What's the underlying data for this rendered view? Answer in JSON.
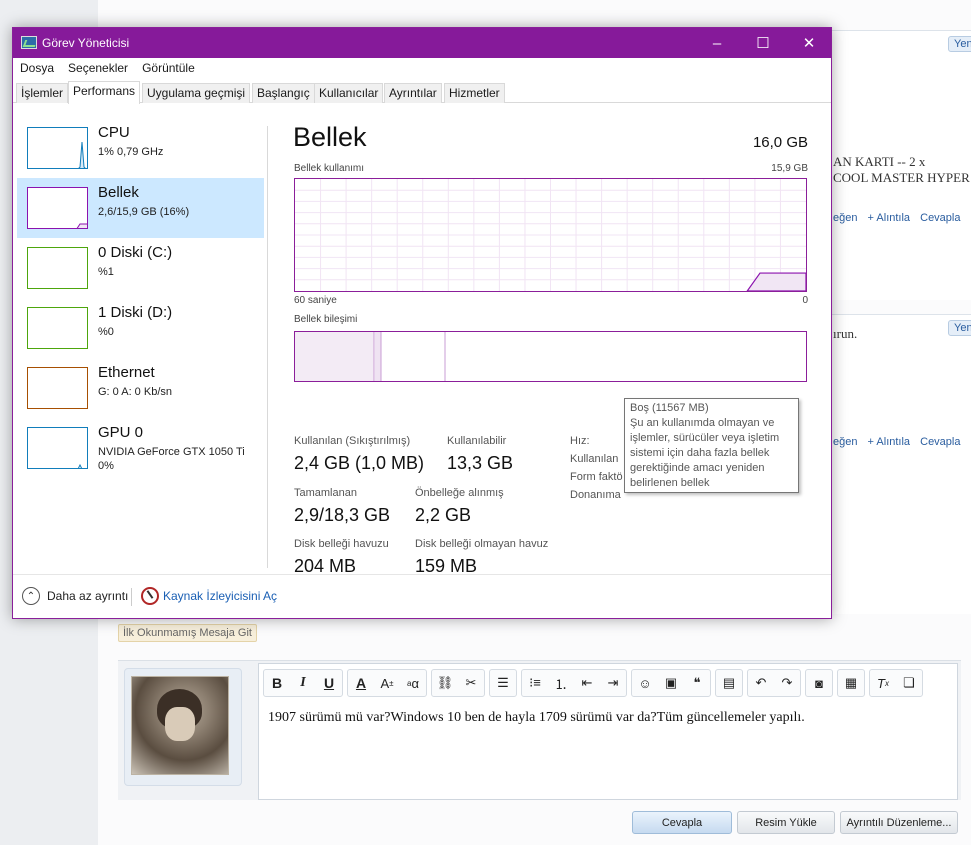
{
  "forum": {
    "yeni_button": "Yeni",
    "post1_line1": "AN KARTI -- 2 x",
    "post1_line2": "COOL MASTER HYPER",
    "post_action_like": "eğen",
    "post_action_quote": "+ Alıntıla",
    "post_action_reply": "Cevapla",
    "post2_text": "ırun.",
    "unread_link": "İlk Okunmamış Mesaja Git",
    "editor_text": "1907 sürümü mü var?Windows 10 ben de hayla 1709 sürümü var da?Tüm güncellemeler yapılı.",
    "buttons": {
      "reply": "Cevapla",
      "upload": "Resim Yükle",
      "advanced": "Ayrıntılı Düzenleme..."
    },
    "toolbar_icons": [
      "bold-icon",
      "italic-icon",
      "underline-icon",
      "font-color-icon",
      "font-size-icon",
      "font-family-icon",
      "link-icon",
      "unlink-icon",
      "align-icon",
      "bullet-list-icon",
      "number-list-icon",
      "outdent-icon",
      "indent-icon",
      "smiley-icon",
      "media-icon",
      "quote-icon",
      "save-icon",
      "undo-icon",
      "redo-icon",
      "camera-icon",
      "table-icon",
      "remove-format-icon",
      "spoiler-icon"
    ]
  },
  "taskmanager": {
    "title": "Görev Yöneticisi",
    "menu": [
      "Dosya",
      "Seçenekler",
      "Görüntüle"
    ],
    "tabs": [
      "İşlemler",
      "Performans",
      "Uygulama geçmişi",
      "Başlangıç",
      "Kullanıcılar",
      "Ayrıntılar",
      "Hizmetler"
    ],
    "active_tab": "Performans",
    "sidebar": [
      {
        "name": "CPU",
        "sub": "1% 0,79 GHz",
        "sub2": "",
        "color": "#117dbb"
      },
      {
        "name": "Bellek",
        "sub": "2,6/15,9 GB (16%)",
        "sub2": "",
        "color": "#8b12ae"
      },
      {
        "name": "0 Diski (C:)",
        "sub": "%1",
        "sub2": "",
        "color": "#4da60c"
      },
      {
        "name": "1 Diski (D:)",
        "sub": "%0",
        "sub2": "",
        "color": "#4da60c"
      },
      {
        "name": "Ethernet",
        "sub": "G: 0 A: 0 Kb/sn",
        "sub2": "",
        "color": "#a74f01"
      },
      {
        "name": "GPU 0",
        "sub": "NVIDIA GeForce GTX 1050 Ti",
        "sub2": "0%",
        "color": "#117dbb"
      }
    ],
    "main": {
      "title": "Bellek",
      "total": "16,0 GB",
      "usage_label": "Bellek kullanımı",
      "usage_max": "15,9 GB",
      "time_label": "60 saniye",
      "time_zero": "0",
      "composition_label": "Bellek bileşimi",
      "used_fraction": 0.16
    },
    "stats": {
      "in_use_label": "Kullanılan (Sıkıştırılmış)",
      "in_use_value": "2,4 GB (1,0 MB)",
      "available_label": "Kullanılabilir",
      "available_value": "13,3 GB",
      "committed_label": "Tamamlanan",
      "committed_value": "2,9/18,3 GB",
      "cached_label": "Önbelleğe alınmış",
      "cached_value": "2,2 GB",
      "paged_label": "Disk belleği havuzu",
      "paged_value": "204 MB",
      "nonpaged_label": "Disk belleği olmayan havuz",
      "nonpaged_value": "159 MB",
      "speed_label": "Hız:",
      "used_slots_label": "Kullanılan",
      "form_factor_label": "Form faktö",
      "hw_reserved_label": "Donanıma"
    },
    "tooltip": {
      "title": "Boş (11567 MB)",
      "line1": "Şu an kullanımda olmayan ve",
      "line2": "işlemler, sürücüler veya işletim",
      "line3": "sistemi için daha fazla bellek",
      "line4": "gerektiğinde amacı yeniden",
      "line5": "belirlenen bellek"
    },
    "footer": {
      "fewer_details": "Daha az ayrıntı",
      "open_monitor": "Kaynak İzleyicisini Aç"
    }
  }
}
